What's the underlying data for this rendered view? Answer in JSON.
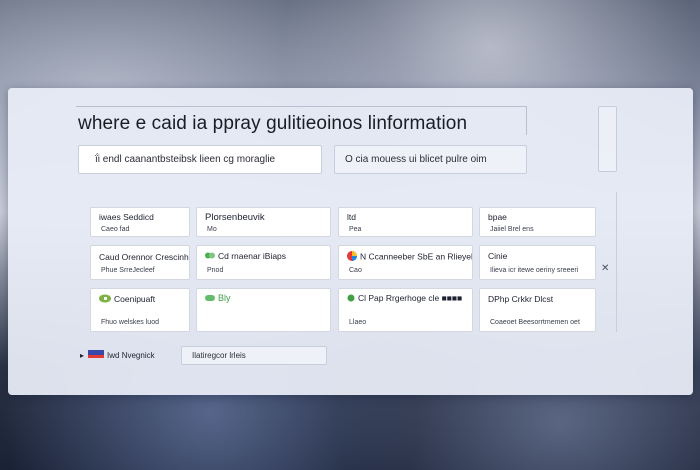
{
  "page": {
    "title": "where e caid ia ppray gulitieoinos linformation"
  },
  "fields": {
    "left_value": "ḯi endl caanantbsteibsk lieen cg moraglie",
    "right_value": "O cia mouess ui blicet pulre oim"
  },
  "cards": [
    {
      "title": "iwaes Seddicd",
      "sub": "Caeo fad",
      "tag": "",
      "icon": "none"
    },
    {
      "title": "Plorsenbeuvik",
      "sub": "Mo",
      "tag": "",
      "icon": "none"
    },
    {
      "title": "ltd",
      "sub": "Pea",
      "tag": "",
      "icon": "none"
    },
    {
      "title": "bpae",
      "sub": "Jaiiel Brel ens",
      "tag": "",
      "icon": "none"
    },
    {
      "title": "Caud Orennor Crescinher",
      "sub": "Phue SrreJecleef",
      "tag": "",
      "icon": "none"
    },
    {
      "title": "Cd rnaenar iBiaps",
      "sub": "Pnod",
      "tag": "",
      "icon": "green-logo-icon"
    },
    {
      "title": "N Ccanneeber SbE an Rlieyel",
      "sub": "Cao",
      "tag": "",
      "icon": "multicolor-logo-icon"
    },
    {
      "title": "Cinie",
      "sub": "Ilieva icr itewe oeriny sreeeri",
      "tag": "✕",
      "icon": "none"
    },
    {
      "title": "Coenipuaft",
      "sub": "Fhuo welskes luod",
      "tag": "",
      "icon": "leaf-logo-icon"
    },
    {
      "title": "Bly",
      "sub": "",
      "tag": "",
      "icon": "green-dot-icon"
    },
    {
      "title": "Cl Pap Rrgerhoge cle ■■■■",
      "sub": "Llaeo",
      "tag": "",
      "icon": "green-dot-icon"
    },
    {
      "title": "DPhp Crkkr Dlcst",
      "sub": "Coaeoet Beesorrtmemen oet",
      "tag": "",
      "icon": "none"
    }
  ],
  "footer": {
    "left_label": "Iwd Nvegnick",
    "left_prefix": "▸",
    "field_value": "Ilatiregcor lrleis"
  }
}
